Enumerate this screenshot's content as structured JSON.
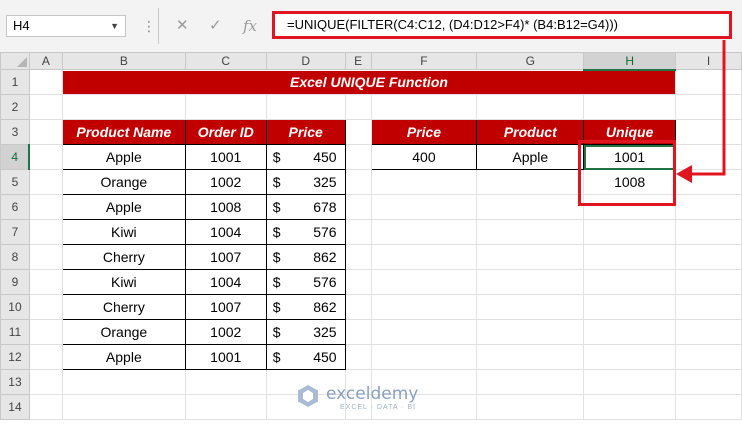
{
  "formula_bar": {
    "name_box": "H4",
    "formula": "=UNIQUE(FILTER(C4:C12, (D4:D12>F4)* (B4:B12=G4)))",
    "cancel_symbol": "✕",
    "enter_symbol": "✓",
    "fx_symbol": "fx"
  },
  "columns": [
    "A",
    "B",
    "C",
    "D",
    "E",
    "F",
    "G",
    "H",
    "I"
  ],
  "rows": [
    "1",
    "2",
    "3",
    "4",
    "5",
    "6",
    "7",
    "8",
    "9",
    "10",
    "11",
    "12",
    "13",
    "14"
  ],
  "title": "Excel UNIQUE Function",
  "main_table": {
    "headers": [
      "Product Name",
      "Order ID",
      "Price"
    ],
    "rows": [
      {
        "product": "Apple",
        "order_id": "1001",
        "currency": "$",
        "price": "450"
      },
      {
        "product": "Orange",
        "order_id": "1002",
        "currency": "$",
        "price": "325"
      },
      {
        "product": "Apple",
        "order_id": "1008",
        "currency": "$",
        "price": "678"
      },
      {
        "product": "Kiwi",
        "order_id": "1004",
        "currency": "$",
        "price": "576"
      },
      {
        "product": "Cherry",
        "order_id": "1007",
        "currency": "$",
        "price": "862"
      },
      {
        "product": "Kiwi",
        "order_id": "1004",
        "currency": "$",
        "price": "576"
      },
      {
        "product": "Cherry",
        "order_id": "1007",
        "currency": "$",
        "price": "862"
      },
      {
        "product": "Orange",
        "order_id": "1002",
        "currency": "$",
        "price": "325"
      },
      {
        "product": "Apple",
        "order_id": "1001",
        "currency": "$",
        "price": "450"
      }
    ]
  },
  "criteria_table": {
    "headers": [
      "Price",
      "Product",
      "Unique"
    ],
    "price": "400",
    "product": "Apple",
    "unique": [
      "1001",
      "1008"
    ]
  },
  "watermark": {
    "name": "exceldemy",
    "tagline": "EXCEL · DATA · BI"
  },
  "colors": {
    "header_fill": "#c00000",
    "highlight": "#e0151f",
    "excel_green": "#217346"
  }
}
